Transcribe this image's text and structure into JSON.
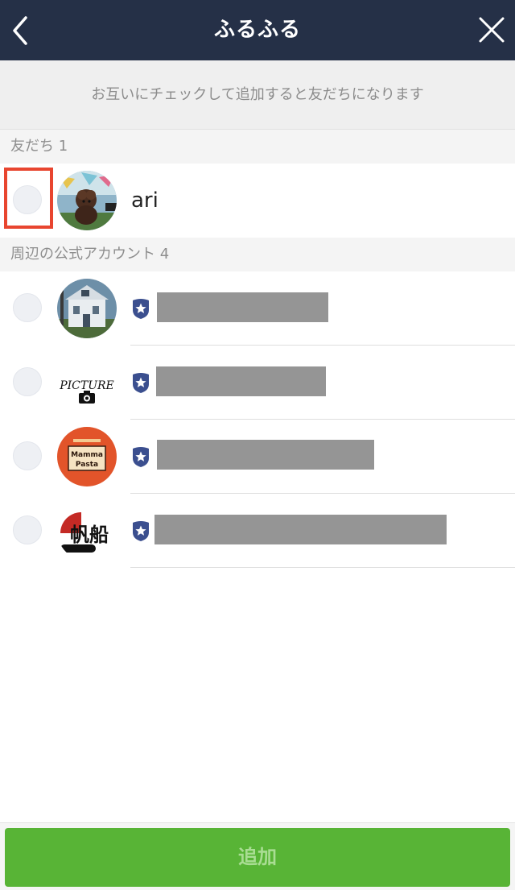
{
  "header": {
    "title": "ふるふる",
    "back_icon": "chevron-left-icon",
    "close_icon": "close-icon"
  },
  "hint": "お互いにチェックして追加すると友だちになります",
  "friends": {
    "header": "友だち 1",
    "items": [
      {
        "name": "ari",
        "checked": false
      }
    ]
  },
  "official_accounts": {
    "header": "周辺の公式アカウント 4",
    "items": [
      {
        "name": "[redacted]",
        "badge": "official-star-badge",
        "checked": false
      },
      {
        "name": "[redacted]",
        "badge": "official-star-badge",
        "checked": false,
        "logo_text": "PICTURE"
      },
      {
        "name": "[redacted]",
        "badge": "official-star-badge",
        "checked": false,
        "logo_text": "Mamma Pasta"
      },
      {
        "name": "[redacted]",
        "badge": "official-star-badge",
        "checked": false,
        "logo_text": "帆船"
      }
    ]
  },
  "footer": {
    "add_label": "追加",
    "enabled": false
  },
  "colors": {
    "nav": "#253047",
    "accent_green": "#58b436",
    "badge_blue": "#3b4f8f",
    "highlight": "#e8452f"
  }
}
